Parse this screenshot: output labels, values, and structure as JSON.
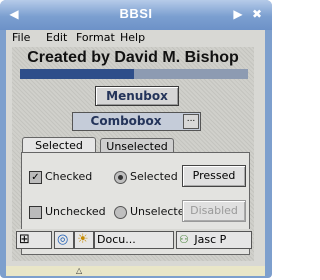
{
  "window": {
    "title": "BBSI",
    "left_controls": "◀",
    "right_controls": [
      "▶",
      "✖"
    ]
  },
  "menu": [
    "File",
    "Edit",
    "Format",
    "Help"
  ],
  "heading": "Created by David M. Bishop",
  "progress_fraction": 0.5,
  "buttons": {
    "menubox": "Menubox",
    "combobox": "Combobox",
    "pressed": "Pressed",
    "disabled": "Disabled"
  },
  "tabs": {
    "selected": "Selected",
    "unselected": "Unselected"
  },
  "options": {
    "checked": "Checked",
    "unchecked": "Unchecked",
    "radio_selected": "Selected",
    "radio_unselected": "Unselected"
  },
  "taskbar": {
    "task1": "Docu...",
    "task2": "Jasc P"
  },
  "icons": {
    "start": "⊞",
    "ie": "◎",
    "sun": "☀",
    "jasc": "⚇"
  }
}
